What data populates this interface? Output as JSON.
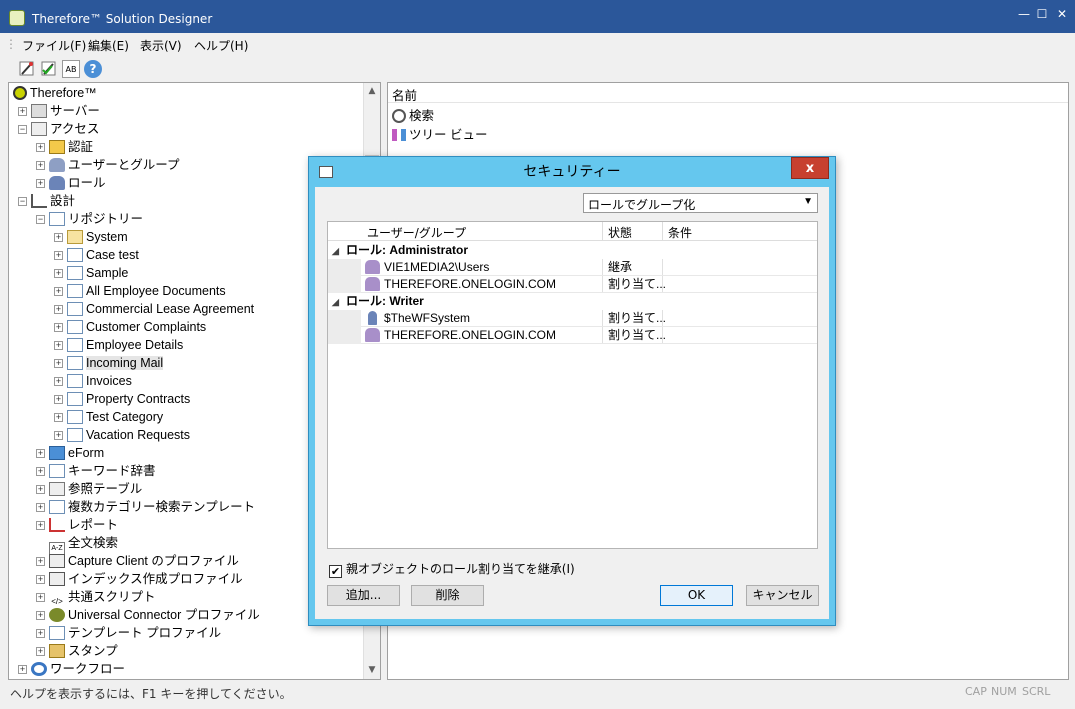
{
  "window": {
    "title": "Therefore™ Solution Designer",
    "controls": [
      "—",
      "☐",
      "✕"
    ]
  },
  "menu": [
    "ファイル(F)",
    "編集(E)",
    "表示(V)",
    "ヘルプ(H)"
  ],
  "toolbar": {
    "icons": [
      "wand-icon",
      "wand-check-icon",
      "text-icon",
      "help-icon"
    ],
    "text_icon_label": "AB",
    "help_label": "?"
  },
  "tree": {
    "root": "Therefore™",
    "server": "サーバー",
    "access": "アクセス",
    "auth": "認証",
    "users_groups": "ユーザーとグループ",
    "roles": "ロール",
    "design": "設計",
    "repository": "リポジトリー",
    "categories": [
      "System",
      "Case test",
      "Sample",
      "All Employee Documents",
      "Commercial Lease Agreement",
      "Customer Complaints",
      "Employee Details",
      "Incoming Mail",
      "Invoices",
      "Property Contracts",
      "Test Category",
      "Vacation Requests"
    ],
    "items": [
      "eForm",
      "キーワード辞書",
      "参照テーブル",
      "複数カテゴリー検索テンプレート",
      "レポート",
      "全文検索",
      "Capture Client のプロファイル",
      "インデックス作成プロファイル",
      "共通スクリプト",
      "Universal Connector プロファイル",
      "テンプレート プロファイル",
      "スタンプ"
    ],
    "fulltext_icon": "A-Z",
    "script_icon": "</>",
    "workflow": "ワークフロー",
    "expander_plus": "+",
    "expander_minus": "−"
  },
  "list": {
    "header": "名前",
    "items": [
      "検索",
      "ツリー ビュー"
    ]
  },
  "status": {
    "text": "ヘルプを表示するには、F1 キーを押してください。",
    "indicators": [
      "CAP",
      "NUM",
      "SCRL"
    ]
  },
  "scroll": {
    "up": "▲",
    "down": "▼"
  },
  "dialog": {
    "title": "セキュリティー",
    "close": "x",
    "group_by": "ロールでグループ化",
    "caret": "▼",
    "columns": [
      "ユーザー/グループ",
      "状態",
      "条件"
    ],
    "groups": [
      {
        "label": "ロール: Administrator",
        "rows": [
          {
            "name": "VIE1MEDIA2\\Users",
            "status": "継承"
          },
          {
            "name": "THEREFORE.ONELOGIN.COM",
            "status": "割り当て..."
          }
        ]
      },
      {
        "label": "ロール: Writer",
        "rows": [
          {
            "name": "$TheWFSystem",
            "status": "割り当て..."
          },
          {
            "name": "THEREFORE.ONELOGIN.COM",
            "status": "割り当て..."
          }
        ]
      }
    ],
    "group_toggle": "◢",
    "inherit_label": "親オブジェクトのロール割り当てを継承(I)",
    "inherit_checked": "✔",
    "buttons": {
      "add": "追加...",
      "delete": "削除",
      "ok": "OK",
      "cancel": "キャンセル"
    }
  }
}
